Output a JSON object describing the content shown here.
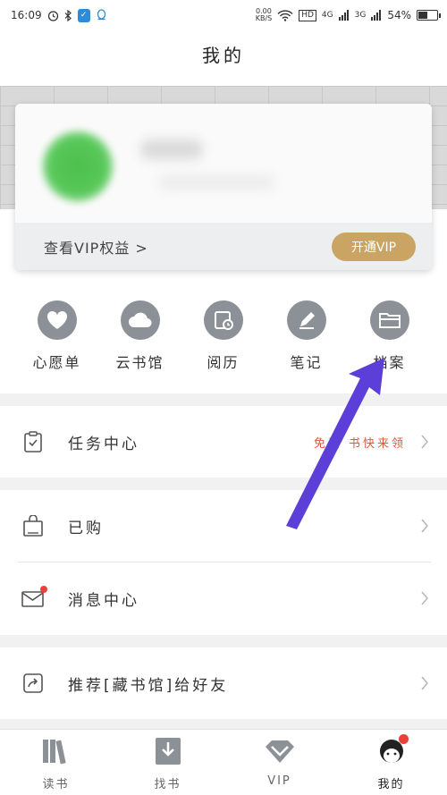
{
  "status_bar": {
    "time": "16:09",
    "net_speed_value": "0.00",
    "net_speed_unit": "KB/S",
    "hd": "HD",
    "sig1": "4G",
    "sig2": "3G",
    "battery": "54%",
    "battery_level": 0.54
  },
  "header": {
    "title": "我的"
  },
  "profile_card": {
    "vip_link": "查看VIP权益 >",
    "vip_button": "开通VIP"
  },
  "quick_actions": [
    {
      "label": "心愿单",
      "icon": "heart-icon"
    },
    {
      "label": "云书馆",
      "icon": "cloud-icon"
    },
    {
      "label": "阅历",
      "icon": "calendar-clock-icon"
    },
    {
      "label": "笔记",
      "icon": "pen-icon"
    },
    {
      "label": "档案",
      "icon": "folder-icon"
    }
  ],
  "menu": {
    "task_center": {
      "label": "任务中心",
      "extra": "免费 书快来领",
      "icon": "clipboard-icon"
    },
    "purchased": {
      "label": "已购",
      "icon": "shopping-bag-icon"
    },
    "messages": {
      "label": "消息中心",
      "icon": "mail-icon",
      "badge_color": "#e8413a"
    },
    "recommend": {
      "label": "推荐[藏书馆]给好友",
      "icon": "share-icon"
    }
  },
  "bottom_nav": [
    {
      "label": "读书",
      "icon": "books-icon"
    },
    {
      "label": "找书",
      "icon": "download-book-icon"
    },
    {
      "label": "VIP",
      "icon": "diamond-icon"
    },
    {
      "label": "我的",
      "icon": "profile-avatar-icon",
      "active": true
    }
  ],
  "colors": {
    "accent_gold": "#c9a463",
    "promo_red": "#e4533a",
    "icon_gray": "#8c9097",
    "annotation_arrow": "#5b3fd8"
  }
}
